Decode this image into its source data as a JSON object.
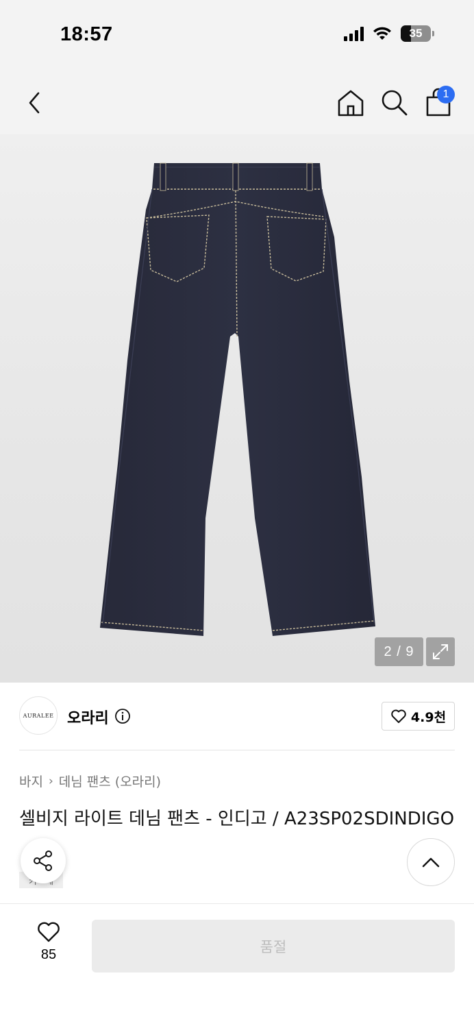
{
  "status_bar": {
    "time": "18:57",
    "battery_level": "35",
    "icons": [
      "signal-icon",
      "wifi-icon",
      "battery-icon"
    ]
  },
  "nav": {
    "icons": [
      "back-chevron-icon",
      "home-icon",
      "search-icon",
      "cart-icon"
    ],
    "cart_badge": "1"
  },
  "image": {
    "counter": "2 / 9",
    "subject": "jeans-back-view",
    "denim_color": "#2a2c3d"
  },
  "brand": {
    "logo_text": "AURALEE",
    "name": "오라리",
    "like_count": "4.9천"
  },
  "product": {
    "breadcrumb": [
      "바지",
      "데님 팬츠 (오라리)"
    ],
    "title": "셀비지 라이트 데님 팬츠 - 인디고 / A23SP02SDINDIGO",
    "tag": "키 · 세"
  },
  "bottom": {
    "wish_count": "85",
    "buy_button_label": "품절"
  },
  "colors": {
    "header_bg": "#f3f3f3",
    "badge": "#2c6df2",
    "soldout_bg": "#ebebeb",
    "soldout_text": "#bdbdbd"
  }
}
